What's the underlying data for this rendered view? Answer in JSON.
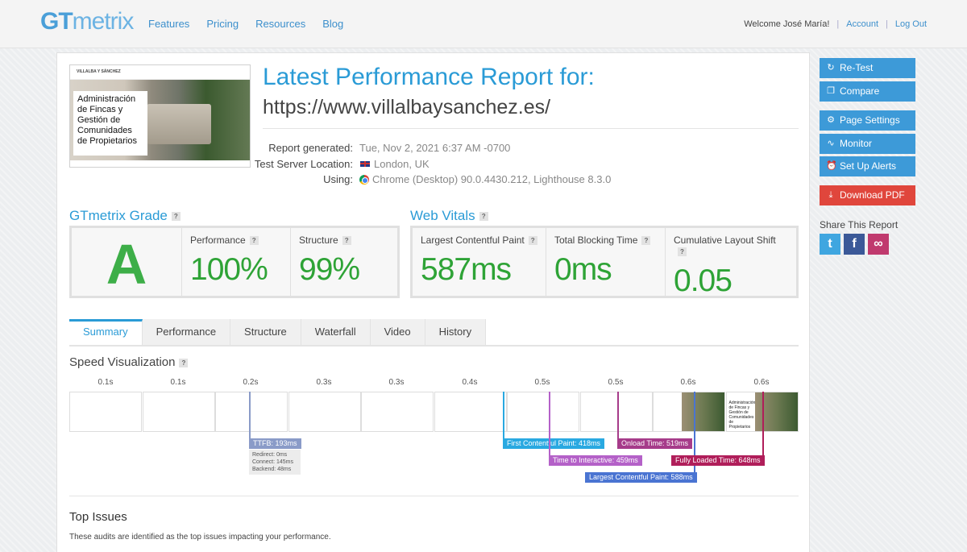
{
  "header": {
    "logo_gt": "GT",
    "logo_metrix": "metrix",
    "nav": [
      "Features",
      "Pricing",
      "Resources",
      "Blog"
    ],
    "welcome": "Welcome José María!",
    "account": "Account",
    "logout": "Log Out"
  },
  "thumbnail": {
    "brand": "VILLALBA Y SÁNCHEZ",
    "card_text": "Administración de Fincas y Gestión de Comunidades de Propietarios"
  },
  "report": {
    "title": "Latest Performance Report for:",
    "url": "https://www.villalbaysanchez.es/",
    "generated_label": "Report generated:",
    "generated_value": "Tue, Nov 2, 2021 6:37 AM -0700",
    "location_label": "Test Server Location:",
    "location_value": "London, UK",
    "using_label": "Using:",
    "using_value": "Chrome (Desktop) 90.0.4430.212, Lighthouse 8.3.0"
  },
  "grade": {
    "title": "GTmetrix Grade",
    "letter": "A",
    "performance_label": "Performance",
    "performance_value": "100%",
    "structure_label": "Structure",
    "structure_value": "99%"
  },
  "vitals": {
    "title": "Web Vitals",
    "lcp_label": "Largest Contentful Paint",
    "lcp_value": "587ms",
    "tbt_label": "Total Blocking Time",
    "tbt_value": "0ms",
    "cls_label": "Cumulative Layout Shift",
    "cls_value": "0.05"
  },
  "tabs": [
    "Summary",
    "Performance",
    "Structure",
    "Waterfall",
    "Video",
    "History"
  ],
  "speed": {
    "title": "Speed Visualization",
    "ticks": [
      "0.1s",
      "0.1s",
      "0.2s",
      "0.3s",
      "0.3s",
      "0.4s",
      "0.5s",
      "0.5s",
      "0.6s",
      "0.6s"
    ],
    "ttfb": "TTFB: 193ms",
    "ttfb_redirect": "Redirect: 0ms",
    "ttfb_connect": "Connect: 145ms",
    "ttfb_backend": "Backend: 48ms",
    "fcp": "First Contentful Paint: 418ms",
    "tti": "Time to Interactive: 459ms",
    "lcp": "Largest Contentful Paint: 588ms",
    "onload": "Onload Time: 519ms",
    "fully_loaded": "Fully Loaded Time: 648ms",
    "frame_text": "Administración de Fincas y Gestión de Comunidades de Propietarios"
  },
  "issues": {
    "title": "Top Issues",
    "desc": "These audits are identified as the top issues impacting your performance."
  },
  "sidebar": {
    "retest": "Re-Test",
    "compare": "Compare",
    "page_settings": "Page Settings",
    "monitor": "Monitor",
    "alerts": "Set Up Alerts",
    "pdf": "Download PDF",
    "share": "Share This Report"
  },
  "colors": {
    "accent": "#2a9bd6",
    "grade_green": "#3dae48",
    "pdf_red": "#e0463c",
    "ttfb": "#8a9bc8",
    "fcp": "#29a9e1",
    "tti": "#b461c8",
    "lcp": "#4a74d2",
    "onload": "#a63b8a",
    "fully_loaded": "#b01e5a"
  }
}
